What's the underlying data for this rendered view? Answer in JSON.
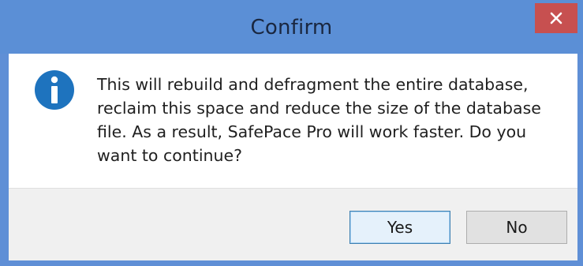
{
  "window": {
    "title": "Confirm"
  },
  "titlebar": {
    "close_icon": "close-icon"
  },
  "dialog": {
    "icon": "info-icon",
    "message": "This will rebuild and defragment the entire database, reclaim this space and reduce the size of the database file. As a result, SafePace Pro will work faster. Do you want to continue?"
  },
  "buttons": {
    "yes_label": "Yes",
    "no_label": "No"
  },
  "colors": {
    "titlebar": "#5b8fd6",
    "close_button": "#c75050",
    "info_icon": "#1e73be",
    "footer": "#f0f0f0"
  }
}
